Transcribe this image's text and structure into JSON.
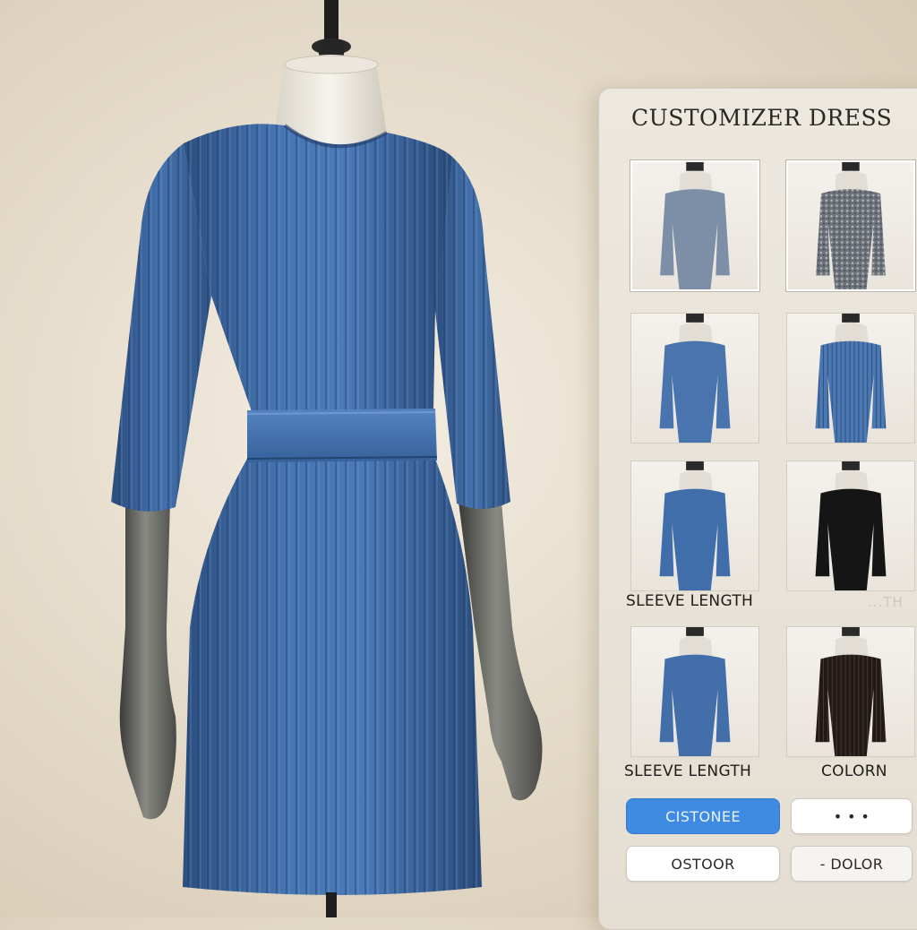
{
  "panel": {
    "title": "CUSTOMIZER DRESS",
    "labels": {
      "sleeve_length_1": "SLEEVE LENGTH",
      "sleeve_length_2": "SLEEVE LENGTH",
      "color": "COLORN",
      "faded": "...TH"
    },
    "buttons": {
      "customize": "CISTONEE",
      "dots": "•          •   •",
      "custom_color": "OSTOOR",
      "color": "- DOLOR"
    },
    "thumbnails": [
      {
        "style": "gray-plain",
        "selected": true
      },
      {
        "style": "gray-speckled",
        "selected": true
      },
      {
        "style": "blue-plain",
        "selected": false
      },
      {
        "style": "blue-ribbed",
        "selected": false
      },
      {
        "style": "blue-satin",
        "selected": false
      },
      {
        "style": "black-plain",
        "selected": false
      },
      {
        "style": "blue-satin-2",
        "selected": false
      },
      {
        "style": "black-ribbed",
        "selected": false
      }
    ]
  },
  "colors": {
    "dress_blue": "#3e6aa3",
    "primary_button": "#3f8ae2",
    "background": "#e6dccb"
  }
}
